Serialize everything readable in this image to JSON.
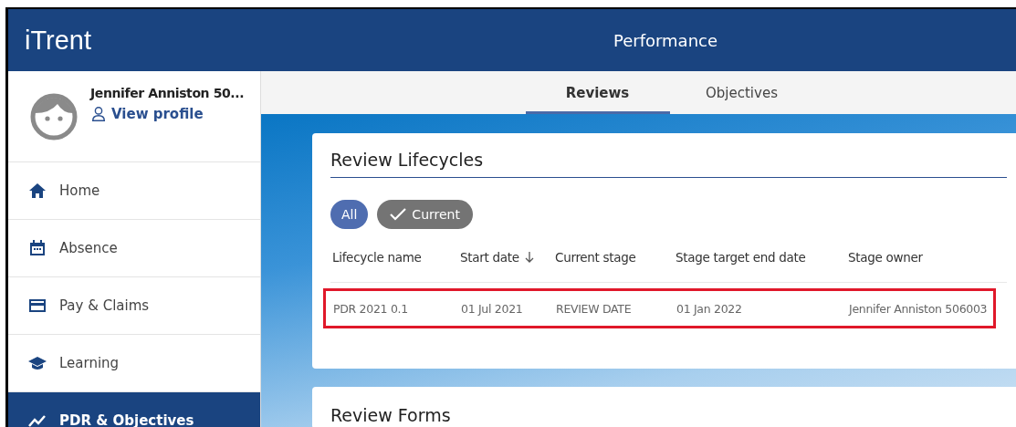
{
  "app": {
    "logo": "iTrent",
    "title": "Performance"
  },
  "profile": {
    "name": "Jennifer Anniston 50...",
    "link": "View profile"
  },
  "sidebar": {
    "items": [
      {
        "label": "Home",
        "kind": "home",
        "selected": false
      },
      {
        "label": "Absence",
        "kind": "absence",
        "selected": false
      },
      {
        "label": "Pay & Claims",
        "kind": "pay",
        "selected": false
      },
      {
        "label": "Learning",
        "kind": "learning",
        "selected": false
      },
      {
        "label": "PDR & Objectives",
        "kind": "pdr",
        "selected": true
      }
    ]
  },
  "tabs": [
    {
      "label": "Reviews",
      "selected": true
    },
    {
      "label": "Objectives",
      "selected": false
    }
  ],
  "lifecycles": {
    "title": "Review Lifecycles",
    "filters": [
      {
        "label": "All",
        "checked": false
      },
      {
        "label": "Current",
        "checked": true
      }
    ],
    "columns": [
      {
        "label": "Lifecycle name",
        "sorted": false
      },
      {
        "label": "Start date",
        "sorted": true
      },
      {
        "label": "Current stage",
        "sorted": false
      },
      {
        "label": "Stage target end date",
        "sorted": false
      },
      {
        "label": "Stage owner",
        "sorted": false
      }
    ],
    "rows": [
      {
        "cells": [
          "PDR 2021 0.1",
          "01 Jul 2021",
          "REVIEW DATE",
          "01 Jan 2022",
          "Jennifer Anniston 506003"
        ],
        "highlighted": true
      }
    ]
  },
  "forms": {
    "title": "Review Forms"
  }
}
